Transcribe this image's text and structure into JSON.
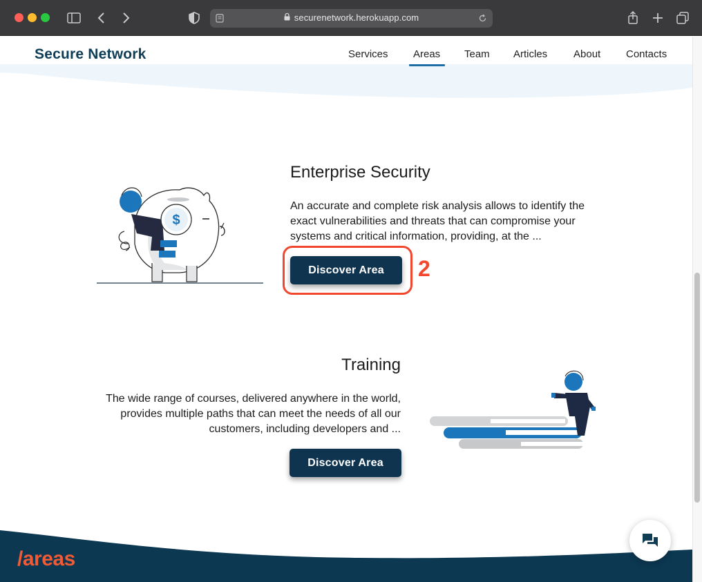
{
  "browser": {
    "url": "securenetwork.herokuapp.com"
  },
  "header": {
    "logo": "Secure Network",
    "nav": [
      "Services",
      "Areas",
      "Team",
      "Articles",
      "About",
      "Contacts"
    ],
    "active_nav": "Areas"
  },
  "sections": [
    {
      "title": "Enterprise Security",
      "lines": [
        "An accurate and complete risk analysis allows to identify the",
        "exact vulnerabilities and threats that can compromise your",
        "systems and critical information, providing, at the ..."
      ],
      "button": "Discover Area"
    },
    {
      "title": "Training",
      "lines": [
        "The wide range of courses, delivered anywhere in the world,",
        "provides multiple paths that can meet the needs of all our",
        "customers, including developers and ..."
      ],
      "button": "Discover Area"
    }
  ],
  "annotation": {
    "number": "2",
    "color": "#f2462f"
  },
  "footer": {
    "label": "/areas"
  },
  "colors": {
    "brand": "#0f3d56",
    "button": "#0f3450",
    "accent": "#f25a36",
    "illustration_blue": "#1b76bc"
  },
  "icons": {
    "chat": "chat-bubbles-icon",
    "piggy": "piggy-bank-illustration",
    "stairs": "climbing-stairs-illustration",
    "dollar": "dollar-coin-icon"
  }
}
